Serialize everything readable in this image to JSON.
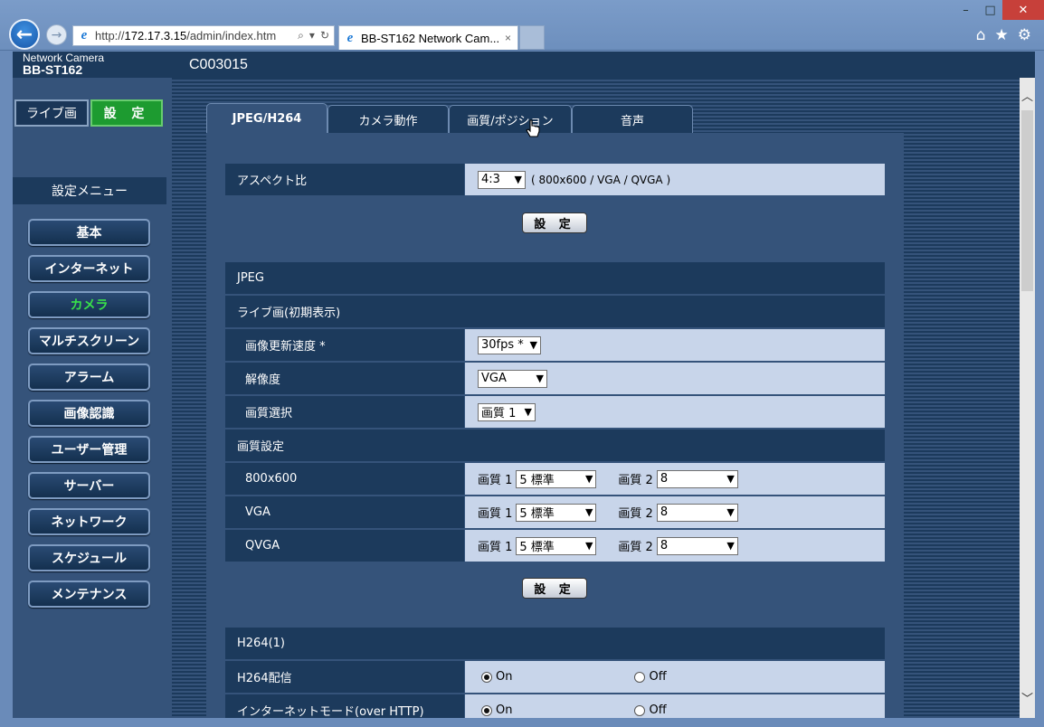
{
  "browser": {
    "url_prefix": "http://",
    "url_host": "172.17.3.15",
    "url_path": "/admin/index.htm",
    "tab_title": "BB-ST162 Network Cam...",
    "tab_close": "×",
    "search_glyph": "⌕",
    "dropdown_glyph": "▾",
    "refresh_glyph": "↻",
    "home_glyph": "⌂",
    "star_glyph": "★",
    "gear_glyph": "⚙",
    "minimize_glyph": "–",
    "maximize_glyph": "□",
    "close_glyph": "✕",
    "back_glyph": "←",
    "forward_glyph": "→",
    "ie_glyph": "e"
  },
  "header": {
    "brand": "Network Camera",
    "model": "BB-ST162",
    "camera_name": "C003015"
  },
  "sidebar": {
    "live_label": "ライブ画",
    "setup_label": "設 定",
    "menu_title": "設定メニュー",
    "items": [
      {
        "label": "基本"
      },
      {
        "label": "インターネット"
      },
      {
        "label": "カメラ"
      },
      {
        "label": "マルチスクリーン"
      },
      {
        "label": "アラーム"
      },
      {
        "label": "画像認識"
      },
      {
        "label": "ユーザー管理"
      },
      {
        "label": "サーバー"
      },
      {
        "label": "ネットワーク"
      },
      {
        "label": "スケジュール"
      },
      {
        "label": "メンテナンス"
      }
    ]
  },
  "tabs": [
    {
      "label": "JPEG/H264"
    },
    {
      "label": "カメラ動作"
    },
    {
      "label": "画質/ポジション"
    },
    {
      "label": "音声"
    }
  ],
  "form": {
    "aspect_label": "アスペクト比",
    "aspect_value": "4:3",
    "aspect_note": "( 800x600 / VGA / QVGA )",
    "apply_label": "設 定",
    "jpeg_section": "JPEG",
    "live_initial_section": "ライブ画(初期表示)",
    "refresh_rate_label": "画像更新速度 *",
    "refresh_rate_value": "30fps *",
    "resolution_label": "解像度",
    "resolution_value": "VGA",
    "quality_select_label": "画質選択",
    "quality_select_value": "画質 1",
    "quality_settings_section": "画質設定",
    "quality1_label": "画質 1",
    "quality2_label": "画質 2",
    "quality_rows": [
      {
        "label": "800x600",
        "q1": "5 標準",
        "q2": "8"
      },
      {
        "label": "VGA",
        "q1": "5 標準",
        "q2": "8"
      },
      {
        "label": "QVGA",
        "q1": "5 標準",
        "q2": "8"
      }
    ],
    "h264_section": "H264(1)",
    "h264_delivery_label": "H264配信",
    "internet_mode_label": "インターネットモード(over HTTP)",
    "on_label": "On",
    "off_label": "Off",
    "h264_delivery_value": "On",
    "internet_mode_value": "On"
  },
  "scrollbar": {
    "up_glyph": "︿",
    "down_glyph": "﹀"
  },
  "colors": {
    "header_dark": "#1c3a5c",
    "panel": "#35537a",
    "value_cell": "#c8d5ea",
    "active_menu": "#38e04a",
    "setup_green": "#1d9b30"
  }
}
